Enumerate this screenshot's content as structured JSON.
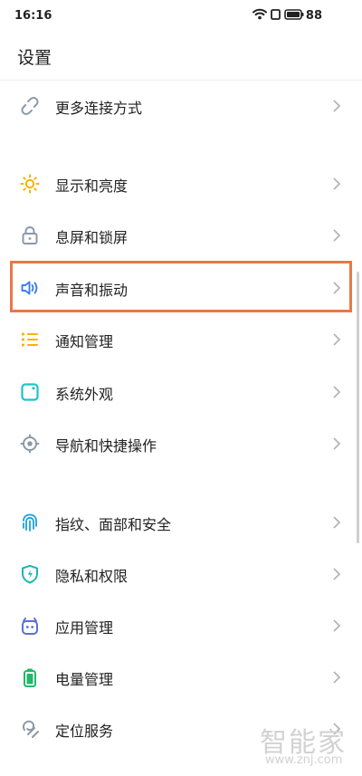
{
  "status": {
    "time": "16:16",
    "battery": "88"
  },
  "header": {
    "title": "设置"
  },
  "items": [
    {
      "label": "更多连接方式",
      "icon": "link-icon",
      "color": "#8a9aa8"
    },
    {
      "label": "显示和亮度",
      "icon": "sun-icon",
      "color": "#f5b400"
    },
    {
      "label": "息屏和锁屏",
      "icon": "lock-icon",
      "color": "#8a9aa8"
    },
    {
      "label": "声音和振动",
      "icon": "speaker-icon",
      "color": "#3b7bf3"
    },
    {
      "label": "通知管理",
      "icon": "list-icon",
      "color": "#f5b400"
    },
    {
      "label": "系统外观",
      "icon": "appearance-icon",
      "color": "#1fc2c7"
    },
    {
      "label": "导航和快捷操作",
      "icon": "navigation-icon",
      "color": "#8a9aa8"
    },
    {
      "label": "指纹、面部和安全",
      "icon": "fingerprint-icon",
      "color": "#1aa0d8"
    },
    {
      "label": "隐私和权限",
      "icon": "shield-icon",
      "color": "#18b8b0"
    },
    {
      "label": "应用管理",
      "icon": "app-icon",
      "color": "#5a6fd8"
    },
    {
      "label": "电量管理",
      "icon": "battery-icon",
      "color": "#22b86b"
    },
    {
      "label": "定位服务",
      "icon": "location-icon",
      "color": "#8a9aa8"
    }
  ],
  "watermark": {
    "main": "智能家",
    "url": "www.znj.com"
  }
}
